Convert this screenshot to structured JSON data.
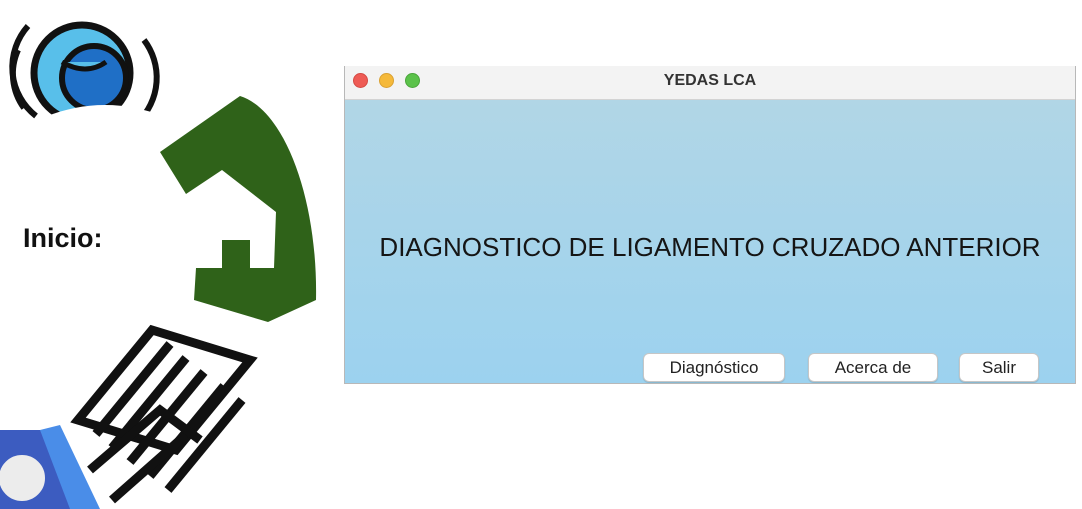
{
  "sidebar": {
    "label": "Inicio:",
    "icons": [
      "eye-icon",
      "home-icon",
      "test-document-icon",
      "user-icon"
    ]
  },
  "window": {
    "title": "YEDAS LCA",
    "heading": "DIAGNOSTICO DE LIGAMENTO CRUZADO ANTERIOR",
    "buttons": {
      "diagnostico": "Diagnóstico",
      "acerca": "Acerca de",
      "salir": "Salir"
    }
  },
  "colors": {
    "content_top": "#b1d6e6",
    "content_bottom": "#9cd2ef",
    "home_icon": "#2f6219",
    "eye_icon": "#58bfea",
    "user_icon": "#4a8de8"
  }
}
